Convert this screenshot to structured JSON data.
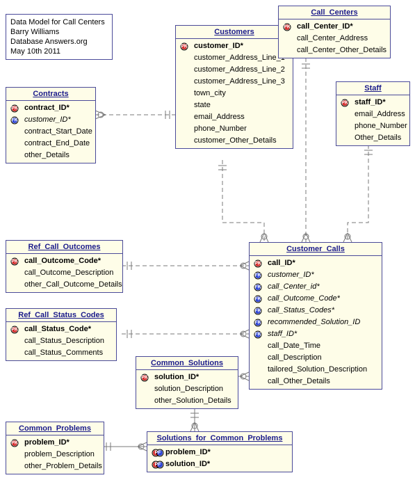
{
  "note": {
    "line1": "Data Model for Call Centers",
    "line2": "Barry Williams",
    "line3": "Database Answers.org",
    "line4": "May 10th 2011"
  },
  "entities": {
    "contracts": {
      "title": "Contracts",
      "attrs": [
        {
          "k": "PK",
          "name": "contract_ID*",
          "key": true
        },
        {
          "k": "FK",
          "name": "customer_ID*",
          "fk": true
        },
        {
          "k": "",
          "name": "contract_Start_Date"
        },
        {
          "k": "",
          "name": "contract_End_Date"
        },
        {
          "k": "",
          "name": "other_Details"
        }
      ]
    },
    "customers": {
      "title": "Customers",
      "attrs": [
        {
          "k": "PK",
          "name": "customer_ID*",
          "key": true
        },
        {
          "k": "",
          "name": "customer_Address_Line_1"
        },
        {
          "k": "",
          "name": "customer_Address_Line_2"
        },
        {
          "k": "",
          "name": "customer_Address_Line_3"
        },
        {
          "k": "",
          "name": "town_city"
        },
        {
          "k": "",
          "name": "state"
        },
        {
          "k": "",
          "name": "email_Address"
        },
        {
          "k": "",
          "name": "phone_Number"
        },
        {
          "k": "",
          "name": "customer_Other_Details"
        }
      ]
    },
    "call_centers": {
      "title": "Call_Centers",
      "attrs": [
        {
          "k": "PK",
          "name": "call_Center_ID*",
          "key": true
        },
        {
          "k": "",
          "name": "call_Center_Address"
        },
        {
          "k": "",
          "name": "call_Center_Other_Details"
        }
      ]
    },
    "staff": {
      "title": "Staff",
      "attrs": [
        {
          "k": "PK",
          "name": "staff_ID*",
          "key": true
        },
        {
          "k": "",
          "name": "email_Address"
        },
        {
          "k": "",
          "name": "phone_Number"
        },
        {
          "k": "",
          "name": "Other_Details"
        }
      ]
    },
    "ref_call_outcomes": {
      "title": "Ref_Call_Outcomes",
      "attrs": [
        {
          "k": "PK",
          "name": "call_Outcome_Code*",
          "key": true
        },
        {
          "k": "",
          "name": "call_Outcome_Description"
        },
        {
          "k": "",
          "name": "other_Call_Outcome_Details"
        }
      ]
    },
    "ref_call_status_codes": {
      "title": "Ref_Call_Status_Codes",
      "attrs": [
        {
          "k": "PK",
          "name": "call_Status_Code*",
          "key": true
        },
        {
          "k": "",
          "name": "call_Status_Description"
        },
        {
          "k": "",
          "name": "call_Status_Comments"
        }
      ]
    },
    "customer_calls": {
      "title": "Customer_Calls",
      "attrs": [
        {
          "k": "PK",
          "name": "call_ID*",
          "key": true
        },
        {
          "k": "FK",
          "name": "customer_ID*",
          "fk": true
        },
        {
          "k": "FK",
          "name": "call_Center_id*",
          "fk": true
        },
        {
          "k": "FK",
          "name": "call_Outcome_Code*",
          "fk": true
        },
        {
          "k": "FK",
          "name": "call_Status_Codes*",
          "fk": true
        },
        {
          "k": "FK",
          "name": "recommended_Solution_ID",
          "fk": true
        },
        {
          "k": "FK",
          "name": "staff_ID*",
          "fk": true
        },
        {
          "k": "",
          "name": "call_Date_Time"
        },
        {
          "k": "",
          "name": "call_Description"
        },
        {
          "k": "",
          "name": "tailored_Solution_Description"
        },
        {
          "k": "",
          "name": "call_Other_Details"
        }
      ]
    },
    "common_solutions": {
      "title": "Common_Solutions",
      "attrs": [
        {
          "k": "PK",
          "name": "solution_ID*",
          "key": true
        },
        {
          "k": "",
          "name": "solution_Description"
        },
        {
          "k": "",
          "name": "other_Solution_Details"
        }
      ]
    },
    "common_problems": {
      "title": "Common_Problems",
      "attrs": [
        {
          "k": "PK",
          "name": "problem_ID*",
          "key": true
        },
        {
          "k": "",
          "name": "problem_Description"
        },
        {
          "k": "",
          "name": "other_Problem_Details"
        }
      ]
    },
    "solutions_for_common_problems": {
      "title": "Solutions_for_Common_Problems",
      "attrs": [
        {
          "k": "PF",
          "name": "problem_ID*",
          "key": true
        },
        {
          "k": "PF",
          "name": "solution_ID*",
          "key": true
        }
      ]
    }
  },
  "chart_data": {
    "type": "er-diagram",
    "relationships": [
      {
        "from": "Contracts",
        "to": "Customers",
        "style": "dashed"
      },
      {
        "from": "Customer_Calls",
        "to": "Customers",
        "style": "dashed"
      },
      {
        "from": "Customer_Calls",
        "to": "Call_Centers",
        "style": "dashed"
      },
      {
        "from": "Customer_Calls",
        "to": "Staff",
        "style": "dashed"
      },
      {
        "from": "Customer_Calls",
        "to": "Ref_Call_Outcomes",
        "style": "dashed"
      },
      {
        "from": "Customer_Calls",
        "to": "Ref_Call_Status_Codes",
        "style": "dashed"
      },
      {
        "from": "Customer_Calls",
        "to": "Common_Solutions",
        "style": "dashed"
      },
      {
        "from": "Solutions_for_Common_Problems",
        "to": "Common_Solutions",
        "style": "solid"
      },
      {
        "from": "Solutions_for_Common_Problems",
        "to": "Common_Problems",
        "style": "solid"
      }
    ]
  }
}
